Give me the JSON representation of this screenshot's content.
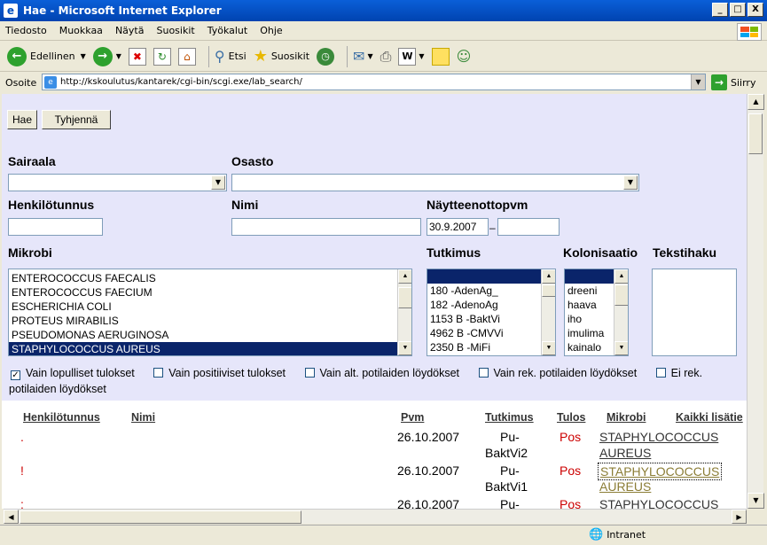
{
  "window": {
    "title": "Hae - Microsoft Internet Explorer",
    "min": "_",
    "max": "□",
    "close": "X"
  },
  "menu": [
    "Tiedosto",
    "Muokkaa",
    "Näytä",
    "Suosikit",
    "Työkalut",
    "Ohje"
  ],
  "toolbar": {
    "back": "Edellinen",
    "search": "Etsi",
    "favorites": "Suosikit"
  },
  "address": {
    "label": "Osoite",
    "url": "http://kskoulutus/kantarek/cgi-bin/scgi.exe/lab_search/",
    "go": "Siirry"
  },
  "form": {
    "search_button": "Hae",
    "clear_button": "Tyhjennä",
    "hospital_label": "Sairaala",
    "department_label": "Osasto",
    "ssn_label": "Henkilötunnus",
    "name_label": "Nimi",
    "sample_date_label": "Näytteenottopvm",
    "sample_date_from": "30.9.2007",
    "date_dash": "–",
    "microbe_label": "Mikrobi",
    "exam_label": "Tutkimus",
    "colonization_label": "Kolonisaatio",
    "textsearch_label": "Tekstihaku",
    "microbes": [
      "ENTEROCOCCUS FAECALIS",
      "ENTEROCOCCUS FAECIUM",
      "ESCHERICHIA COLI",
      "PROTEUS MIRABILIS",
      "PSEUDOMONAS AERUGINOSA",
      "STAPHYLOCOCCUS AUREUS"
    ],
    "exams": [
      "",
      "180 -AdenAg_",
      "182 -AdenoAg",
      "1153 B -BaktVi",
      "4962 B -CMVVi",
      "2350 B -MiFi"
    ],
    "colonizations": [
      "",
      "dreeni",
      "haava",
      "iho",
      "imulima",
      "kainalo"
    ],
    "checkboxes": [
      {
        "label": "Vain lopulliset tulokset",
        "checked": true
      },
      {
        "label": "Vain positiiviset tulokset",
        "checked": false
      },
      {
        "label": "Vain alt. potilaiden löydökset",
        "checked": false
      },
      {
        "label": "Vain rek. potilaiden löydökset",
        "checked": false
      },
      {
        "label": "Ei rek. potilaiden löydökset",
        "checked": false
      }
    ]
  },
  "results": {
    "headers": {
      "ssn": "Henkilötunnus",
      "name": "Nimi",
      "date": "Pvm",
      "exam": "Tutkimus",
      "result": "Tulos",
      "microbe": "Mikrobi",
      "all": "Kaikki lisätie"
    },
    "rows": [
      {
        "mark": ".",
        "date": "26.10.2007",
        "exam1": "Pu-",
        "exam2": "BaktVi2",
        "result": "Pos",
        "m1": "STAPHYLOCOCCUS",
        "m2": "AUREUS"
      },
      {
        "mark": "!",
        "date": "26.10.2007",
        "exam1": "Pu-",
        "exam2": "BaktVi1",
        "result": "Pos",
        "m1": "STAPHYLOCOCCUS",
        "m2": "AUREUS"
      },
      {
        "mark": ":",
        "date": "26.10.2007",
        "exam1": "Pu-",
        "exam2": "",
        "result": "Pos",
        "m1": "STAPHYLOCOCCUS",
        "m2": ""
      }
    ]
  },
  "status": {
    "zone": "Intranet"
  },
  "colors": {
    "title_bar": "#0a5fd8",
    "page_bg": "#e6e6fa",
    "positive": "#cc0000",
    "selected": "#0a246a"
  }
}
